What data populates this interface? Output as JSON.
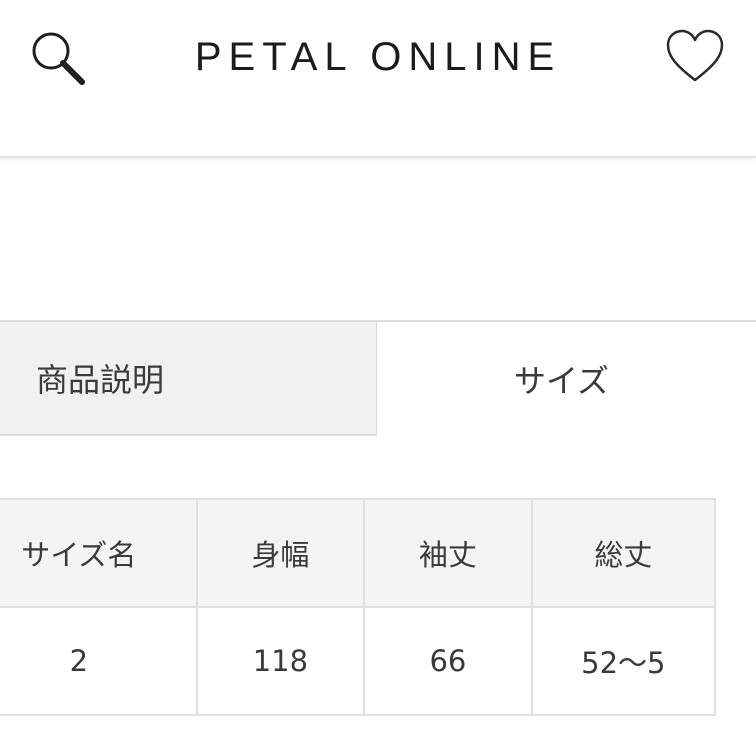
{
  "header": {
    "brand": "PETAL ONLINE",
    "search_icon": "search-icon",
    "favorite_icon": "heart-icon"
  },
  "tabs": [
    {
      "label": "商品説明",
      "active": false
    },
    {
      "label": "サイズ",
      "active": true
    }
  ],
  "size_table": {
    "headers": [
      "サイズ名",
      "身幅",
      "袖丈",
      "総丈"
    ],
    "rows": [
      [
        "2",
        "118",
        "66",
        "52〜5"
      ]
    ]
  },
  "colors": {
    "tab_inactive_bg": "#f1f1f1",
    "table_header_bg": "#f4f4f4",
    "border": "#e0e0e0",
    "text": "#3a3a3a"
  }
}
